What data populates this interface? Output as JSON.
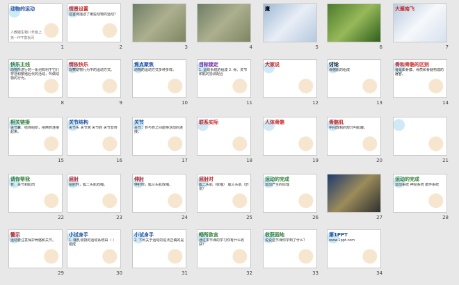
{
  "window": {
    "title": "Slide Sorter"
  },
  "slides": [
    {
      "number": "1",
      "title": "动物的运动",
      "subtitle": "人教版生物八年级上",
      "footer": "第一PPT模板网",
      "style": "pattern-bg",
      "titleColor": "#1f4fa0"
    },
    {
      "number": "2",
      "title": "情景设置",
      "body": "这首诗描述了哪些动物的运动？",
      "style": "pattern-bg",
      "titleColor": "#c62828"
    },
    {
      "number": "3",
      "title": "",
      "body": "",
      "style": "photo"
    },
    {
      "number": "4",
      "title": "",
      "body": "",
      "style": "photo"
    },
    {
      "number": "5",
      "title": "鹰",
      "body": "",
      "style": "photo3"
    },
    {
      "number": "6",
      "title": "",
      "body": "",
      "style": "photo2"
    },
    {
      "number": "7",
      "title": "大雁南飞",
      "body": "",
      "style": "photo4",
      "titleColor": "#c62828"
    },
    {
      "number": "8",
      "title": "快乐主线",
      "body": "动物所进行的一系列有利于它们存活和繁殖后代的活动，叫做动物的行为。",
      "style": "pattern-bg",
      "titleColor": "#2e7d32"
    },
    {
      "number": "9",
      "title": "情依快乐",
      "body": "观察动物行为中的运动方式。",
      "style": "pattern-bg",
      "titleColor": "#c62828"
    },
    {
      "number": "10",
      "title": "焦点聚焦",
      "body": "动物的运动方式多种多样。",
      "style": "pattern-bg",
      "titleColor": "#1f4fa0"
    },
    {
      "number": "11",
      "title": "目标锁定",
      "body": "1. 运动系统的组成  2. 骨、关节和肌的协调配合",
      "style": "pattern-bg",
      "titleColor": "#6a1b9a"
    },
    {
      "number": "12",
      "title": "大家说",
      "body": "",
      "style": "pattern-bg",
      "titleColor": "#c62828"
    },
    {
      "number": "13",
      "title": "讨论",
      "body": "骨骼肌的组成",
      "style": "pattern-bg",
      "titleColor": "#000000"
    },
    {
      "number": "14",
      "title": "骨和骨骼的区别",
      "body": "骨是由骨膜、骨质和骨髓构成的器官。",
      "style": "pattern-bg",
      "titleColor": "#c62828"
    },
    {
      "number": "15",
      "title": "相关链接",
      "body": "关节囊：结缔组织，把两骨连接起来。",
      "style": "pattern-bg",
      "titleColor": "#2e7d32"
    },
    {
      "number": "16",
      "title": "关节结构",
      "body": "关节头 关节窝 关节腔 关节软骨",
      "style": "pattern-bg",
      "titleColor": "#1f4fa0"
    },
    {
      "number": "17",
      "title": "关节",
      "body": "关节：骨与骨之间能够活动的连接。",
      "style": "pattern-bg",
      "titleColor": "#1f4fa0"
    },
    {
      "number": "18",
      "title": "联系实际",
      "body": "",
      "style": "pattern-bg",
      "titleColor": "#c62828"
    },
    {
      "number": "19",
      "title": "人体骨骼",
      "body": "",
      "style": "pattern-bg",
      "titleColor": "#c62828"
    },
    {
      "number": "20",
      "title": "骨骼肌",
      "body": "中间较粗的部分叫肌腹。",
      "style": "pattern-bg",
      "titleColor": "#c62828"
    },
    {
      "number": "21",
      "title": "",
      "body": "",
      "style": "pattern-bg"
    },
    {
      "number": "22",
      "title": "请你帮我",
      "body": "骨、关节和肌肉",
      "style": "pattern-bg",
      "titleColor": "#2e7d32"
    },
    {
      "number": "23",
      "title": "屈肘",
      "body": "屈肘时，肱二头肌收缩。",
      "style": "pattern-bg",
      "titleColor": "#c62828"
    },
    {
      "number": "24",
      "title": "伸肘",
      "body": "伸肘时，肱三头肌收缩。",
      "style": "pattern-bg",
      "titleColor": "#c62828"
    },
    {
      "number": "25",
      "title": "屈肘时",
      "body": "肱二头肌（收缩） 肱三头肌（舒张）",
      "style": "pattern-bg",
      "titleColor": "#c62828"
    },
    {
      "number": "26",
      "title": "运动的完成",
      "body": "运动产生的原理",
      "style": "pattern-bg",
      "titleColor": "#2e7d32"
    },
    {
      "number": "27",
      "title": "",
      "body": "",
      "style": "photo6"
    },
    {
      "number": "28",
      "title": "运动的完成",
      "body": "运动系统 神经系统 循环系统",
      "style": "pattern-bg",
      "titleColor": "#2e7d32"
    },
    {
      "number": "29",
      "title": "警示",
      "body": "运动要注意保护骨骼和关节。",
      "style": "pattern-bg",
      "titleColor": "#c62828"
    },
    {
      "number": "30",
      "title": "小试身手",
      "body": "1. 哺乳动物的运动系统由（ ）组成",
      "style": "pattern-bg",
      "titleColor": "#1f4fa0"
    },
    {
      "number": "31",
      "title": "小试身手",
      "body": "2. 下列关于运动的说法正确的是",
      "style": "pattern-bg",
      "titleColor": "#1f4fa0"
    },
    {
      "number": "32",
      "title": "畅所欲言",
      "body": "通过本节课的学习你有什么收获？",
      "style": "pattern-bg",
      "titleColor": "#2e7d32"
    },
    {
      "number": "33",
      "title": "收获园地",
      "body": "说说这节课你学到了什么？",
      "style": "pattern-bg",
      "titleColor": "#2e7d32"
    },
    {
      "number": "34",
      "title": "第1PPT",
      "body": "www.1ppt.com",
      "style": "pattern-bg",
      "titleColor": "#1f4fa0"
    }
  ]
}
